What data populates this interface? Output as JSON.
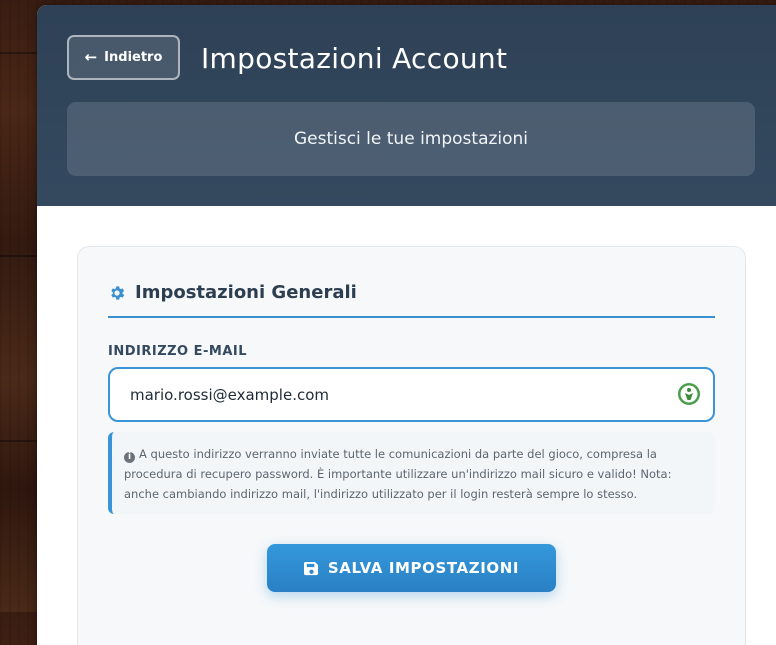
{
  "header": {
    "back_label": "Indietro",
    "title": "Impostazioni Account",
    "subtitle": "Gestisci le tue impostazioni"
  },
  "general": {
    "section_title": "Impostazioni Generali",
    "email_label": "INDIRIZZO E-MAIL",
    "email_value": "mario.rossi@example.com",
    "info_text": "A questo indirizzo verranno inviate tutte le comunicazioni da parte del gioco, compresa la procedura di recupero password. È importante utilizzare un'indirizzo mail sicuro e valido! Nota: anche cambiando indirizzo mail, l'indirizzo utilizzato per il login resterà sempre lo stesso.",
    "save_label": "SALVA IMPOSTAZIONI"
  },
  "icons": {
    "back": "arrow-left-icon",
    "section": "gear-icon",
    "field_badge": "password-manager-icon",
    "info": "info-circle-icon",
    "save": "floppy-disk-icon"
  },
  "colors": {
    "header_bg": "#2e4156",
    "accent": "#3498db",
    "card_bg": "#f6f8fa"
  }
}
